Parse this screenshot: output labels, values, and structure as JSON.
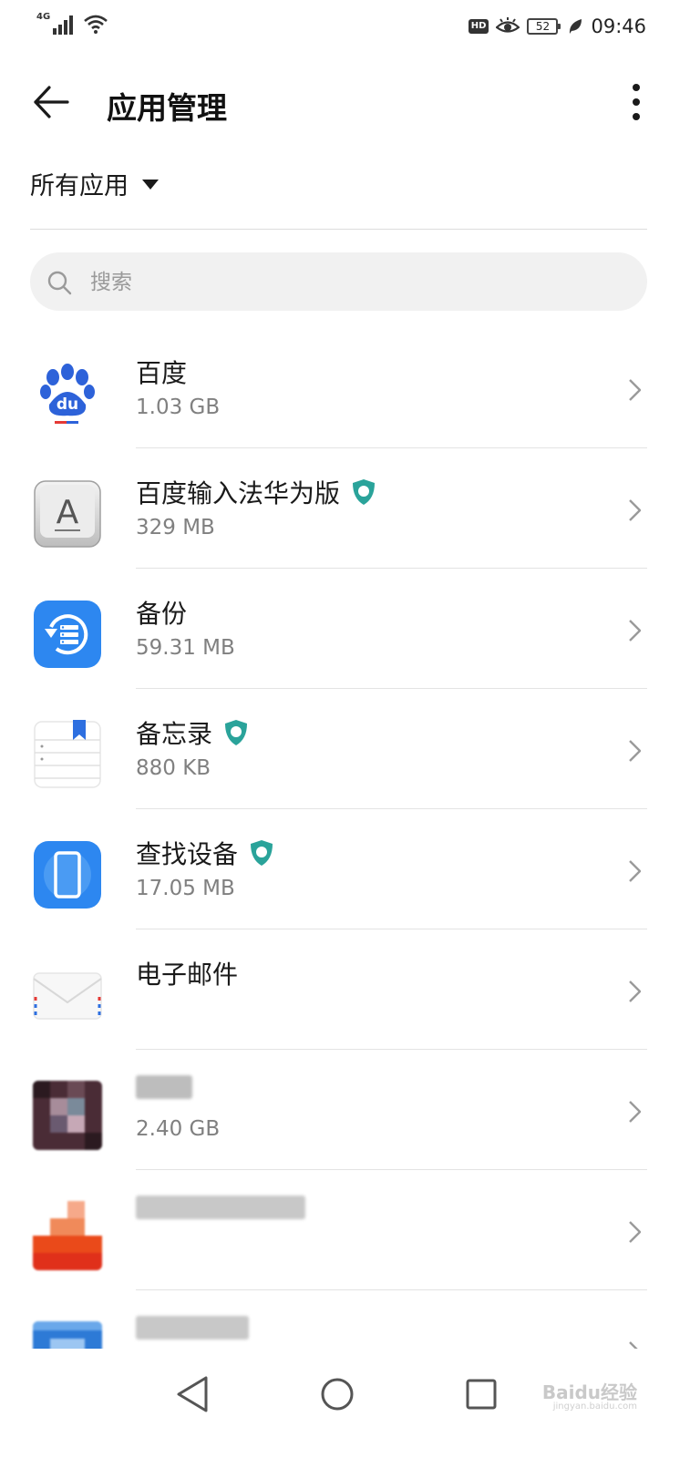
{
  "status_bar": {
    "network_label": "4G",
    "battery_level": "52",
    "time": "09:46",
    "hd_label": "HD",
    "icons": [
      "signal-icon",
      "wifi-icon",
      "hd-icon",
      "eye-comfort-icon",
      "battery-icon",
      "power-saving-leaf-icon"
    ]
  },
  "header": {
    "title": "应用管理",
    "back_icon": "back-arrow-icon",
    "more_icon": "more-vert-icon"
  },
  "filter": {
    "label": "所有应用",
    "icon": "dropdown-triangle-icon"
  },
  "search": {
    "placeholder": "搜索",
    "value": ""
  },
  "apps": [
    {
      "name": "百度",
      "size": "1.03 GB",
      "icon": "baidu-paw-icon",
      "shield": false
    },
    {
      "name": "百度输入法华为版",
      "size": "329 MB",
      "icon": "keyboard-a-icon",
      "shield": true
    },
    {
      "name": "备份",
      "size": "59.31 MB",
      "icon": "backup-icon",
      "shield": false
    },
    {
      "name": "备忘录",
      "size": "880 KB",
      "icon": "notepad-icon",
      "shield": true
    },
    {
      "name": "查找设备",
      "size": "17.05 MB",
      "icon": "find-device-phone-icon",
      "shield": true
    },
    {
      "name": "电子邮件",
      "size": "",
      "icon": "email-envelope-icon",
      "shield": false
    },
    {
      "name": "",
      "size": "2.40 GB",
      "icon": "blurred-app-icon",
      "shield": false
    },
    {
      "name": "",
      "size": "",
      "icon": "blurred-app-icon",
      "shield": false
    },
    {
      "name": "",
      "size": "",
      "icon": "blurred-app-icon",
      "shield": false
    }
  ],
  "nav_bar": {
    "icons": [
      "nav-back-triangle-icon",
      "nav-home-circle-icon",
      "nav-recents-square-icon"
    ]
  },
  "watermark": {
    "text": "Baidu经验",
    "subtext": "jingyan.baidu.com"
  },
  "colors": {
    "accent_blue": "#2d87f0",
    "shield_teal": "#2aa39a",
    "text_primary": "#1a1a1a",
    "text_secondary": "#808080",
    "divider": "#e3e3e3",
    "search_bg": "#f1f1f1"
  }
}
